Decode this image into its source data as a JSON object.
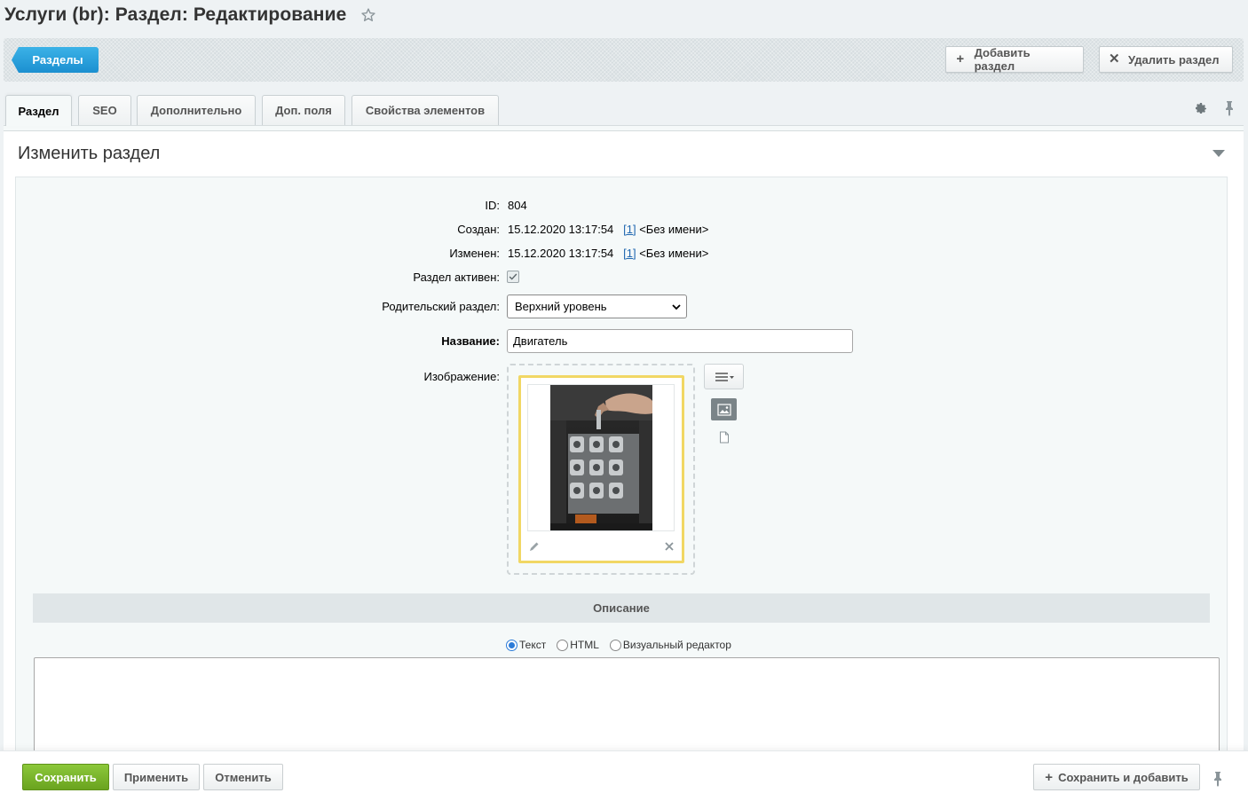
{
  "header": {
    "title": "Услуги (br): Раздел: Редактирование"
  },
  "toolbar": {
    "back_label": "Разделы",
    "add_label": "Добавить раздел",
    "delete_label": "Удалить раздел"
  },
  "tabs": [
    {
      "label": "Раздел",
      "active": true
    },
    {
      "label": "SEO"
    },
    {
      "label": "Дополнительно"
    },
    {
      "label": "Доп. поля"
    },
    {
      "label": "Свойства элементов"
    }
  ],
  "section": {
    "title": "Изменить раздел"
  },
  "form": {
    "id_label": "ID:",
    "id_value": "804",
    "created_label": "Создан:",
    "created_value": "15.12.2020 13:17:54",
    "created_user_id": "[1]",
    "created_user_name": "<Без имени>",
    "modified_label": "Изменен:",
    "modified_value": "15.12.2020 13:17:54",
    "modified_user_id": "[1]",
    "modified_user_name": "<Без имени>",
    "active_label": "Раздел активен:",
    "active_checked": true,
    "parent_label": "Родительский раздел:",
    "parent_value": "Верхний уровень",
    "name_label": "Название:",
    "name_value": "Двигатель",
    "image_label": "Изображение:"
  },
  "description": {
    "header": "Описание",
    "modes": [
      {
        "label": "Текст",
        "selected": true
      },
      {
        "label": "HTML",
        "selected": false
      },
      {
        "label": "Визуальный редактор",
        "selected": false
      }
    ]
  },
  "footer": {
    "save_label": "Сохранить",
    "apply_label": "Применить",
    "cancel_label": "Отменить",
    "save_add_label": "Сохранить и добавить"
  },
  "colors": {
    "primary_blue": "#1b8fd0",
    "save_green": "#6aa31f",
    "image_highlight": "#f1d764",
    "link": "#2067b0"
  }
}
